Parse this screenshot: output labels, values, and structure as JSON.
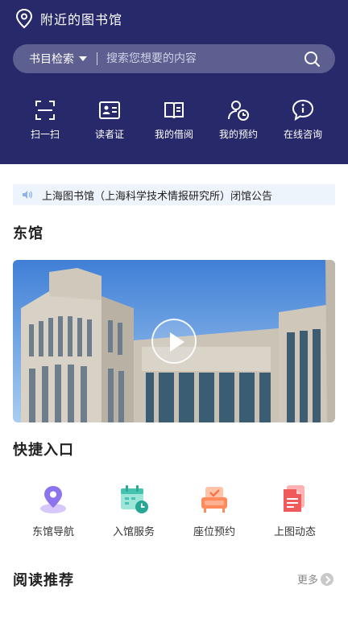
{
  "header": {
    "location_label": "附近的图书馆",
    "search": {
      "category": "书目检索",
      "placeholder": "搜索您想要的内容"
    },
    "quick_actions": [
      {
        "label": "扫一扫",
        "icon": "scan-icon"
      },
      {
        "label": "读者证",
        "icon": "reader-card-icon"
      },
      {
        "label": "我的借阅",
        "icon": "book-icon"
      },
      {
        "label": "我的预约",
        "icon": "user-clock-icon"
      },
      {
        "label": "在线咨询",
        "icon": "chat-info-icon"
      }
    ]
  },
  "notice": {
    "text": "上海图书馆（上海科学技术情报研究所）闭馆公告",
    "icon": "speaker-icon"
  },
  "branch": {
    "title": "东馆"
  },
  "quick_entry": {
    "title": "快捷入口",
    "items": [
      {
        "label": "东馆导航",
        "icon": "map-pin-icon"
      },
      {
        "label": "入馆服务",
        "icon": "calendar-clock-icon"
      },
      {
        "label": "座位预约",
        "icon": "seat-icon"
      },
      {
        "label": "上图动态",
        "icon": "document-icon"
      }
    ]
  },
  "recommend": {
    "title": "阅读推荐",
    "more_label": "更多"
  },
  "colors": {
    "header_bg": "#27296b",
    "search_bg": "#5c5f8f",
    "notice_bg": "#eef4fb"
  }
}
